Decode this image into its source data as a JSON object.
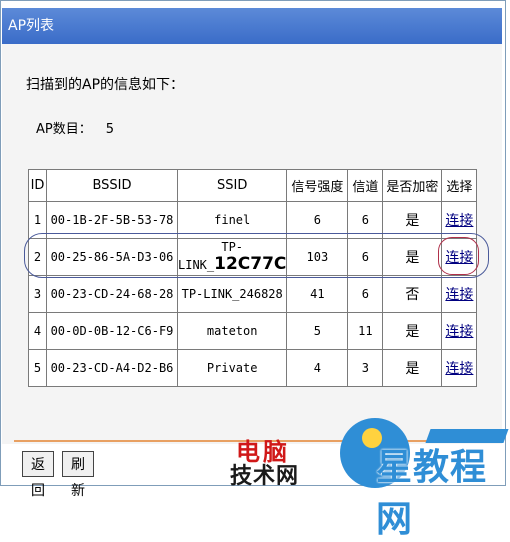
{
  "window": {
    "title": "AP列表"
  },
  "heading": "扫描到的AP的信息如下：",
  "ap_count": {
    "label": "AP数目：",
    "value": "5"
  },
  "table": {
    "headers": [
      "ID",
      "BSSID",
      "SSID",
      "信号强度",
      "信道",
      "是否加密",
      "选择"
    ],
    "rows": [
      {
        "id": "1",
        "bssid": "00-1B-2F-5B-53-78",
        "ssid": "finel",
        "signal": "6",
        "channel": "6",
        "encrypted": "是",
        "action": "连接"
      },
      {
        "id": "2",
        "bssid": "00-25-86-5A-D3-06",
        "ssid_prefix": "TP-LINK_",
        "ssid_suffix": "12C77C",
        "signal": "103",
        "channel": "6",
        "encrypted": "是",
        "action": "连接"
      },
      {
        "id": "3",
        "bssid": "00-23-CD-24-68-28",
        "ssid": "TP-LINK_246828",
        "signal": "41",
        "channel": "6",
        "encrypted": "否",
        "action": "连接"
      },
      {
        "id": "4",
        "bssid": "00-0D-0B-12-C6-F9",
        "ssid": "mateton",
        "signal": "5",
        "channel": "11",
        "encrypted": "是",
        "action": "连接"
      },
      {
        "id": "5",
        "bssid": "00-23-CD-A4-D2-B6",
        "ssid": "Private",
        "signal": "4",
        "channel": "3",
        "encrypted": "是",
        "action": "连接"
      }
    ]
  },
  "buttons": {
    "back": "返回",
    "refresh": "刷新"
  },
  "watermark": {
    "line1": "电脑",
    "line2": "技术网",
    "brand": "星教程网"
  },
  "colors": {
    "titlebar": "#4a7bd0",
    "link": "#000080",
    "highlight_row": "#4a5a9a",
    "highlight_link": "#b0304a"
  }
}
